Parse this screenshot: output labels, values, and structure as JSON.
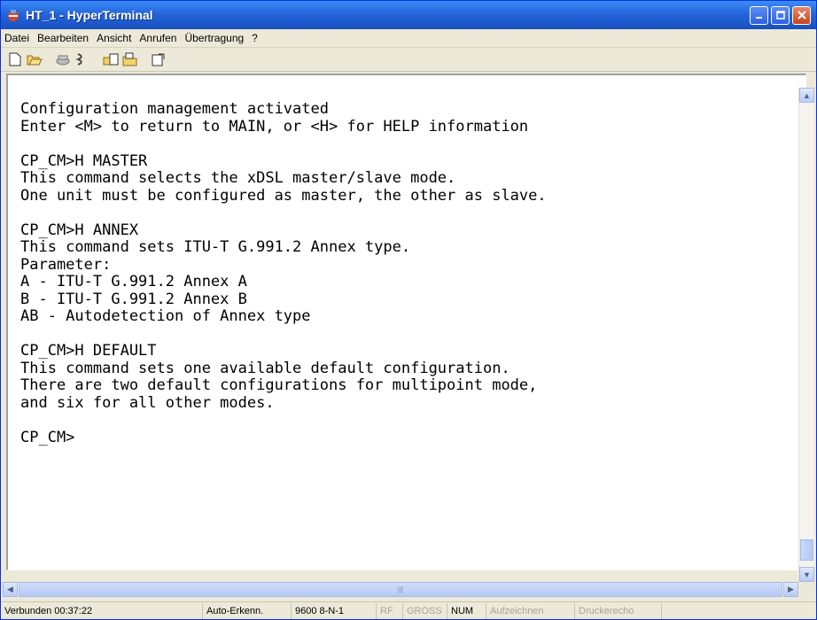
{
  "window": {
    "title": "HT_1 - HyperTerminal"
  },
  "menu": [
    "Datei",
    "Bearbeiten",
    "Ansicht",
    "Anrufen",
    "Übertragung",
    "?"
  ],
  "toolbar": {
    "icons": [
      "new-connection-icon",
      "open-icon",
      "disconnect-icon",
      "properties-icon",
      "send-icon",
      "receive-icon",
      "settings-icon"
    ]
  },
  "terminal": {
    "lines": [
      "Configuration management activated",
      "Enter <M> to return to MAIN, or <H> for HELP information",
      "",
      "CP_CM>H MASTER",
      "This command selects the xDSL master/slave mode.",
      "One unit must be configured as master, the other as slave.",
      "",
      "CP_CM>H ANNEX",
      "This command sets ITU-T G.991.2 Annex type.",
      "Parameter:",
      "A - ITU-T G.991.2 Annex A",
      "B - ITU-T G.991.2 Annex B",
      "AB - Autodetection of Annex type",
      "",
      "CP_CM>H DEFAULT",
      "This command sets one available default configuration.",
      "There are two default configurations for multipoint mode,",
      "and six for all other modes.",
      "",
      "CP_CM>"
    ]
  },
  "status": {
    "connected": "Verbunden 00:37:22",
    "detect": "Auto-Erkenn.",
    "port": "9600 8-N-1",
    "rf": "RF",
    "caps": "GROSS",
    "num": "NUM",
    "capture": "Aufzeichnen",
    "printecho": "Druckerecho"
  }
}
